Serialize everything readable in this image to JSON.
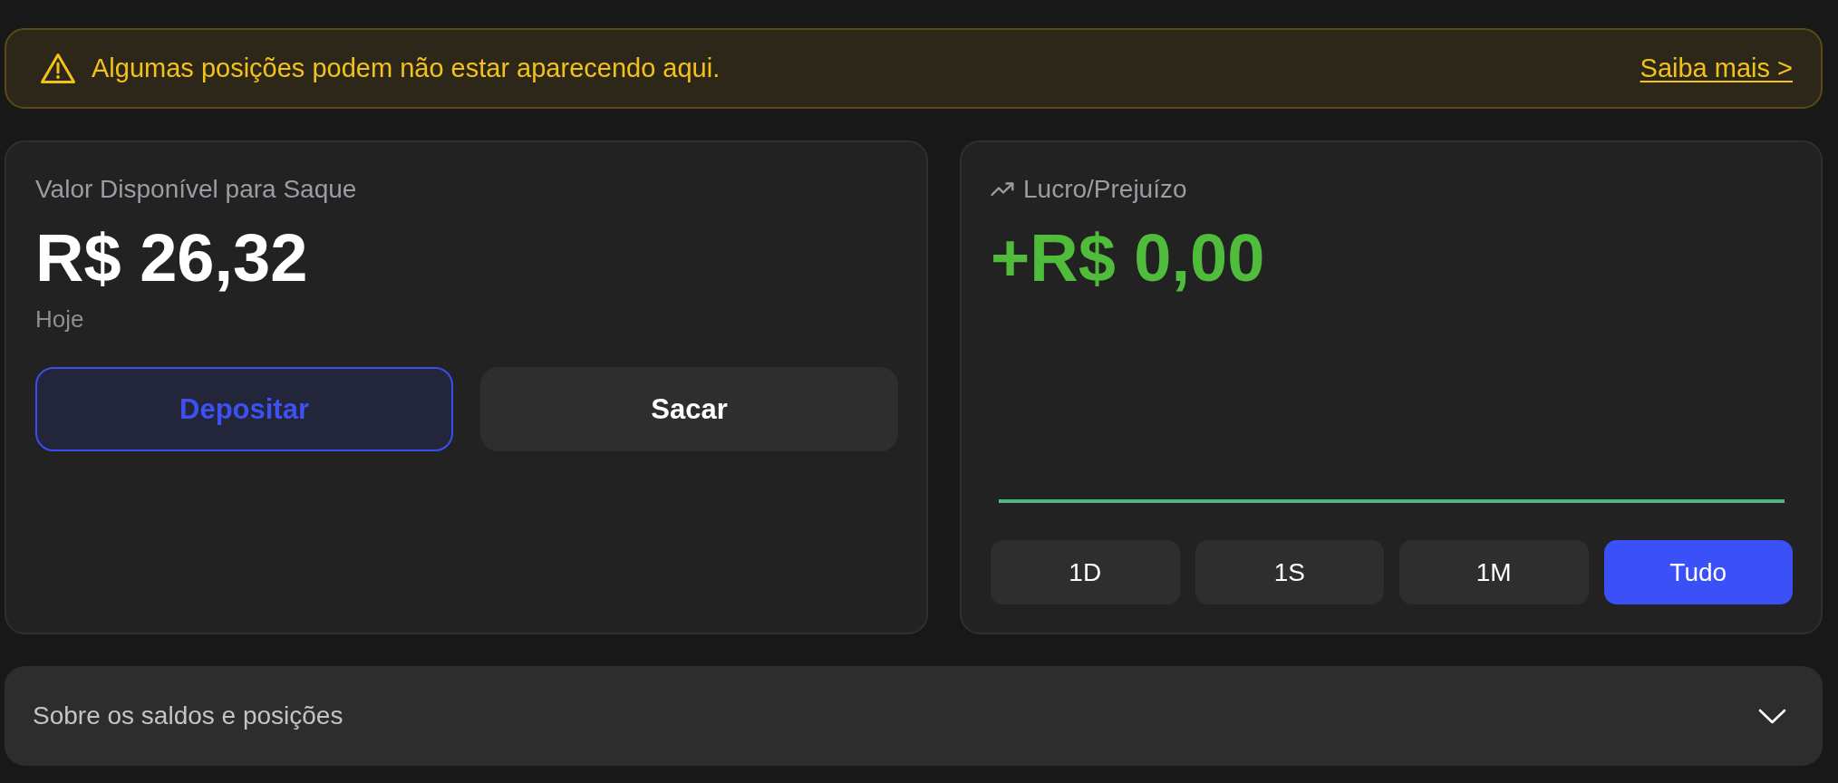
{
  "alert": {
    "text": "Algumas posições podem não estar aparecendo aqui.",
    "link": "Saiba mais >"
  },
  "balance_card": {
    "label": "Valor Disponível para Saque",
    "amount": "R$ 26,32",
    "period": "Hoje",
    "buttons": [
      {
        "label": "Depositar",
        "kind": "outline"
      },
      {
        "label": "Sacar",
        "kind": "filled"
      }
    ]
  },
  "profit_card": {
    "label": "Lucro/Prejuízo",
    "amount": "+R$ 0,00",
    "periods": [
      {
        "label": "1D",
        "selected": false
      },
      {
        "label": "1S",
        "selected": false
      },
      {
        "label": "1M",
        "selected": false
      },
      {
        "label": "Tudo",
        "selected": true
      }
    ]
  },
  "accordion": {
    "title": "Sobre os saldos e posições",
    "expanded": false
  }
}
